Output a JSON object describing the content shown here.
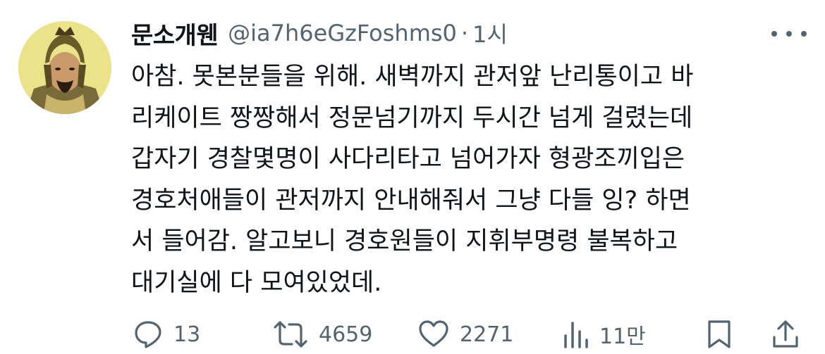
{
  "author": {
    "display_name": "문소개웬",
    "handle": "@ia7h6eGzFoshms0",
    "separator": "·",
    "time": "1시"
  },
  "body_lines": [
    "아참. 못본분들을 위해. 새벽까지 관저앞 난리통이고 바",
    "리케이트 짱짱해서 정문넘기까지 두시간 넘게 걸렸는데",
    "갑자기 경찰몇명이 사다리타고 넘어가자 형광조끼입은",
    "경호처애들이 관저까지 안내해줘서 그냥 다들 잉? 하면",
    "서 들어감. 알고보니 경호원들이 지휘부명령 불복하고",
    "대기실에 다 모여있었데."
  ],
  "actions": {
    "reply_count": "13",
    "retweet_count": "4659",
    "like_count": "2271",
    "views_count": "11만"
  },
  "icons": {
    "avatar": "avatar-portrait",
    "more": "more-icon",
    "reply": "reply-icon",
    "retweet": "retweet-icon",
    "like": "like-icon",
    "views": "views-icon",
    "bookmark": "bookmark-icon",
    "share": "share-icon"
  },
  "colors": {
    "text": "#0f1419",
    "secondary": "#536471",
    "avatar_bg": "#ebe38a"
  }
}
